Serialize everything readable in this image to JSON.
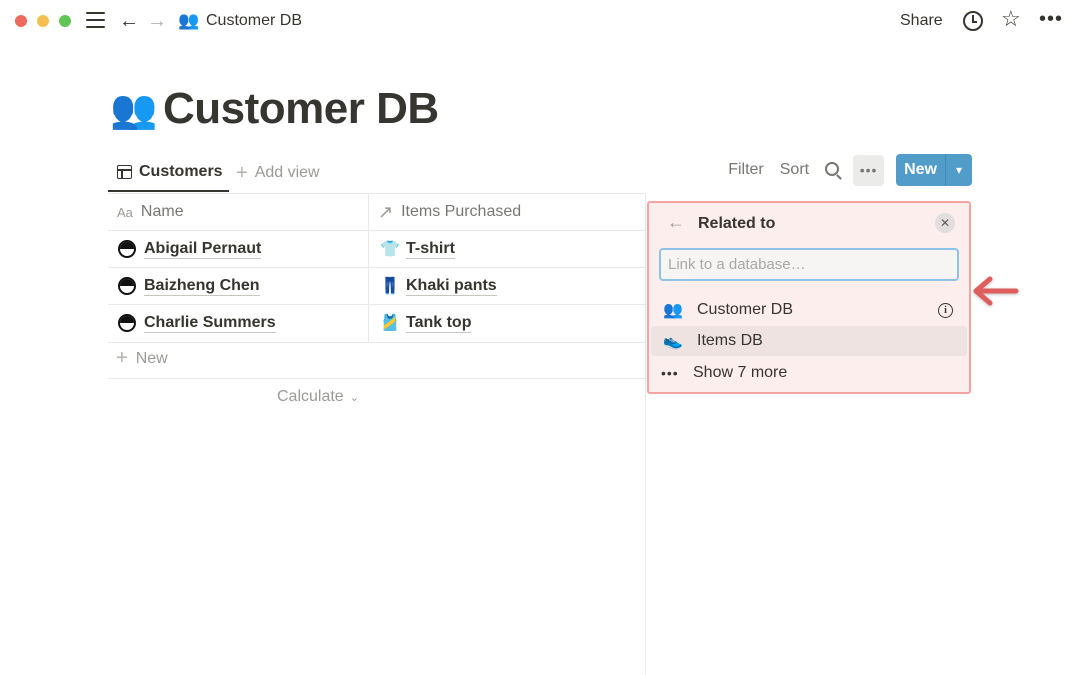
{
  "topbar": {
    "breadcrumb_emoji": "👥",
    "breadcrumb_title": "Customer DB",
    "share_label": "Share",
    "back_icon": "←",
    "forward_icon": "→",
    "star_icon": "☆",
    "more_icon": "•••"
  },
  "page": {
    "emoji": "👥",
    "title": "Customer DB"
  },
  "viewbar": {
    "active_tab": "Customers",
    "add_view_label": "Add view",
    "filter_label": "Filter",
    "sort_label": "Sort",
    "more_label": "•••",
    "new_label": "New",
    "new_dropdown_icon": "⌄"
  },
  "table": {
    "columns": [
      {
        "icon": "Aa",
        "label": "Name"
      },
      {
        "icon": "↗",
        "label": "Items Purchased"
      }
    ],
    "rows": [
      {
        "name": "Abigail Pernaut",
        "item_icon": "👕",
        "item": "T-shirt"
      },
      {
        "name": "Baizheng Chen",
        "item_icon": "👖",
        "item": "Khaki pants"
      },
      {
        "name": "Charlie Summers",
        "item_icon": "🎽",
        "item": "Tank top"
      }
    ],
    "new_row_label": "New",
    "calculate_label": "Calculate"
  },
  "panel": {
    "title": "Related to",
    "input_placeholder": "Link to a database…",
    "input_value": "",
    "items": [
      {
        "icon": "👥",
        "label": "Customer DB"
      },
      {
        "icon": "👟",
        "label": "Items DB"
      },
      {
        "icon": "•••",
        "label": "Show 7 more"
      }
    ],
    "close_icon": "✕",
    "back_icon": "←",
    "info_icon": "i"
  },
  "colors": {
    "accent": "#529cca",
    "highlight_border": "#f4a3a3",
    "highlight_bg": "#fdeeee",
    "arrow": "#e05d5d"
  }
}
